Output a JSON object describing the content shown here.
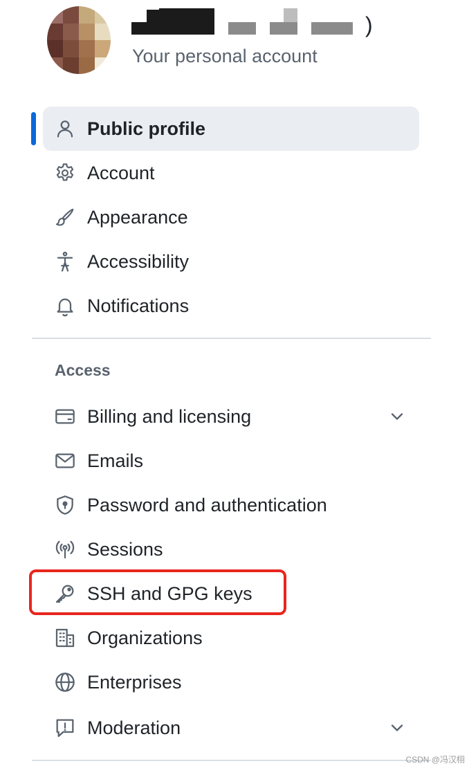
{
  "header": {
    "subtitle": "Your personal account",
    "name_tail": ")"
  },
  "nav": {
    "items": [
      {
        "label": "Public profile",
        "icon": "person-icon"
      },
      {
        "label": "Account",
        "icon": "gear-icon"
      },
      {
        "label": "Appearance",
        "icon": "paintbrush-icon"
      },
      {
        "label": "Accessibility",
        "icon": "accessibility-icon"
      },
      {
        "label": "Notifications",
        "icon": "bell-icon"
      }
    ],
    "access_heading": "Access",
    "access_items": [
      {
        "label": "Billing and licensing",
        "icon": "credit-card-icon"
      },
      {
        "label": "Emails",
        "icon": "mail-icon"
      },
      {
        "label": "Password and authentication",
        "icon": "shield-lock-icon"
      },
      {
        "label": "Sessions",
        "icon": "broadcast-icon"
      },
      {
        "label": "SSH and GPG keys",
        "icon": "key-icon"
      },
      {
        "label": "Organizations",
        "icon": "organization-icon"
      },
      {
        "label": "Enterprises",
        "icon": "globe-icon"
      },
      {
        "label": "Moderation",
        "icon": "report-icon"
      }
    ]
  },
  "watermark": "CSDN @冯汉栩",
  "colors": {
    "active_indicator": "#0969da",
    "active_background": "#eaedf1",
    "highlight_box": "#e8261d"
  }
}
